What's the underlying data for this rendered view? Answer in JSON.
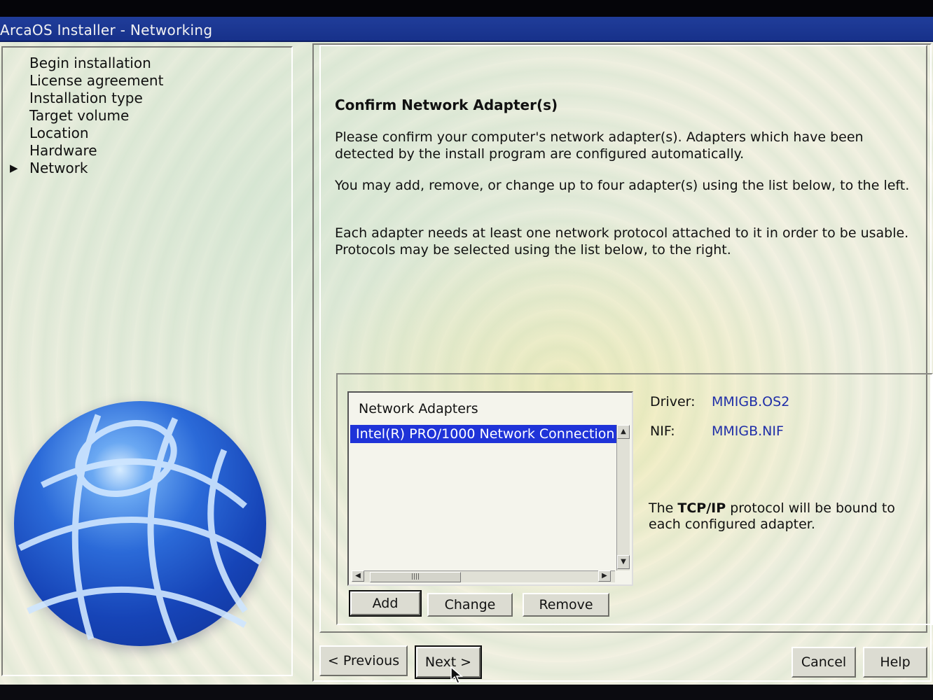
{
  "window": {
    "title": "ArcaOS Installer - Networking"
  },
  "nav": {
    "items": [
      {
        "label": "Begin installation",
        "current": false
      },
      {
        "label": "License agreement",
        "current": false
      },
      {
        "label": "Installation type",
        "current": false
      },
      {
        "label": "Target volume",
        "current": false
      },
      {
        "label": "Location",
        "current": false
      },
      {
        "label": "Hardware",
        "current": false
      },
      {
        "label": "Network",
        "current": true
      }
    ],
    "current_marker": "▶"
  },
  "content": {
    "heading": "Confirm Network Adapter(s)",
    "para1": "Please confirm your computer's network adapter(s). Adapters which have been detected by the install program are configured  automatically.",
    "para2": "You may add, remove, or change up to four adapter(s) using the list below, to the left.",
    "para3": "Each adapter needs at least one network protocol attached to it in order to be usable. Protocols may be selected using the list below,  to the right."
  },
  "adapters": {
    "header": "Network Adapters",
    "items": [
      "Intel(R) PRO/1000 Network Connection"
    ],
    "selected_index": 0
  },
  "details": {
    "driver_label": "Driver:",
    "driver_value": "MMIGB.OS2",
    "nif_label": "NIF:",
    "nif_value": "MMIGB.NIF",
    "tcp_note_prefix": "The ",
    "tcp_note_bold": "TCP/IP",
    "tcp_note_suffix": " protocol will be bound to each configured adapter."
  },
  "buttons": {
    "add": "Add",
    "change": "Change",
    "remove": "Remove",
    "previous": "< Previous",
    "next": "Next >",
    "cancel": "Cancel",
    "help": "Help"
  },
  "icons": {
    "globe": "globe-icon",
    "scroll_up": "scroll-up-arrow-icon",
    "scroll_down": "scroll-down-arrow-icon",
    "scroll_left": "scroll-left-arrow-icon",
    "scroll_right": "scroll-right-arrow-icon",
    "cursor": "mouse-pointer-icon"
  },
  "colors": {
    "titlebar": "#1a3591",
    "selection": "#1f33d8",
    "link_value": "#1f2ea8"
  }
}
